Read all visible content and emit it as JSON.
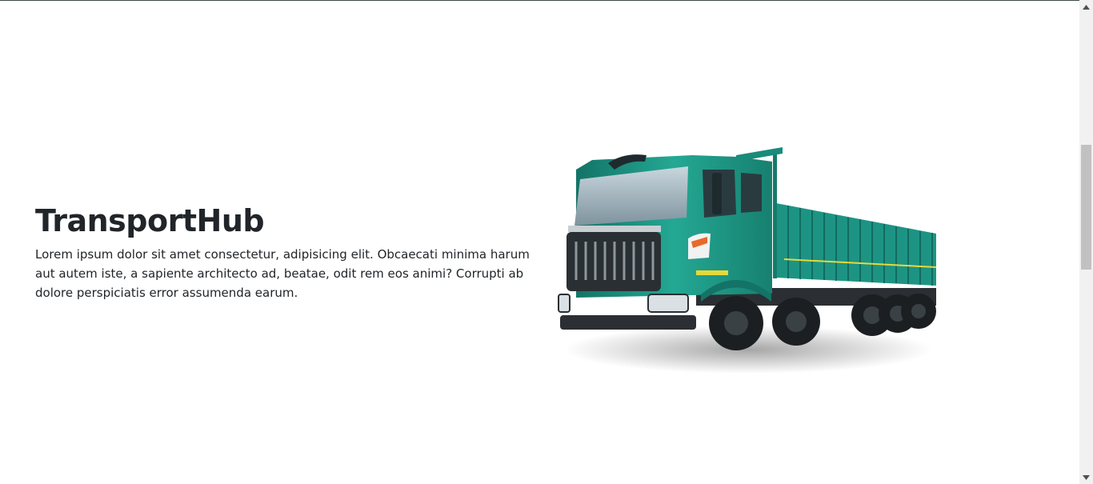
{
  "hero": {
    "title": "TransportHub",
    "description": "Lorem ipsum dolor sit amet consectetur, adipisicing elit. Obcaecati minima harum aut autem iste, a sapiente architecto ad, beatae, odit rem eos animi? Corrupti ab dolore perspiciatis error assumenda earum."
  },
  "image": {
    "subject": "green cargo truck",
    "body_color": "#1f9c8a",
    "body_dark": "#137366",
    "grille_color": "#2a2f33"
  },
  "scrollbar": {
    "up_icon": "triangle-up-icon",
    "down_icon": "triangle-down-icon"
  }
}
